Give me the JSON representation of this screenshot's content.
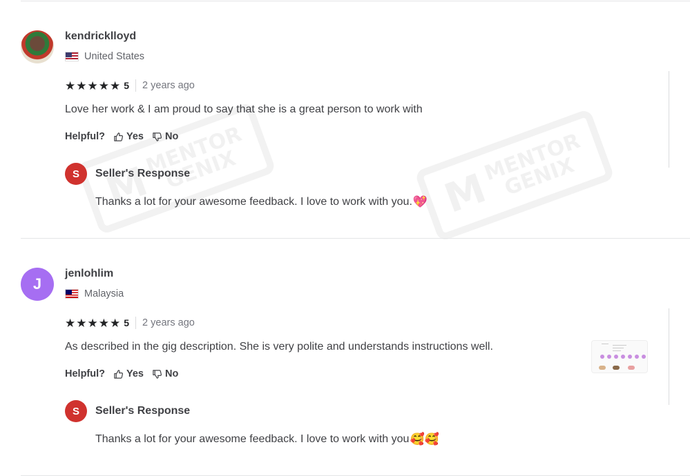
{
  "reviews": [
    {
      "username": "kendricklloyd",
      "country": "United States",
      "flag": "us-flag",
      "avatar_type": "photo",
      "avatar_letter": "",
      "rating": 5,
      "rating_text": "5",
      "time_ago": "2 years ago",
      "text": "Love her work & I am proud to say that she is a great person to work with",
      "helpful_label": "Helpful?",
      "yes_label": "Yes",
      "no_label": "No",
      "seller_response": {
        "avatar_letter": "S",
        "title": "Seller's Response",
        "text": "Thanks a lot for your awesome feedback. I love to work with you. ",
        "emoji": "💖"
      }
    },
    {
      "username": "jenlohlim",
      "country": "Malaysia",
      "flag": "my-flag",
      "avatar_type": "letter",
      "avatar_letter": "J",
      "rating": 5,
      "rating_text": "5",
      "time_ago": "2 years ago",
      "text": "As described in the gig description. She is very polite and understands instructions well.",
      "helpful_label": "Helpful?",
      "yes_label": "Yes",
      "no_label": "No",
      "seller_response": {
        "avatar_letter": "S",
        "title": "Seller's Response",
        "text": "Thanks a lot for your awesome feedback. I love to work with you",
        "emoji": "🥰🥰"
      }
    }
  ],
  "watermark": {
    "logo": "M",
    "line1": "MENTOR",
    "line2": "GENIX"
  },
  "colors": {
    "seller_avatar": "#d0322e",
    "letter_avatar": "#a66ef2",
    "text": "#404145",
    "muted": "#74767e",
    "divider": "#e4e5e7"
  }
}
